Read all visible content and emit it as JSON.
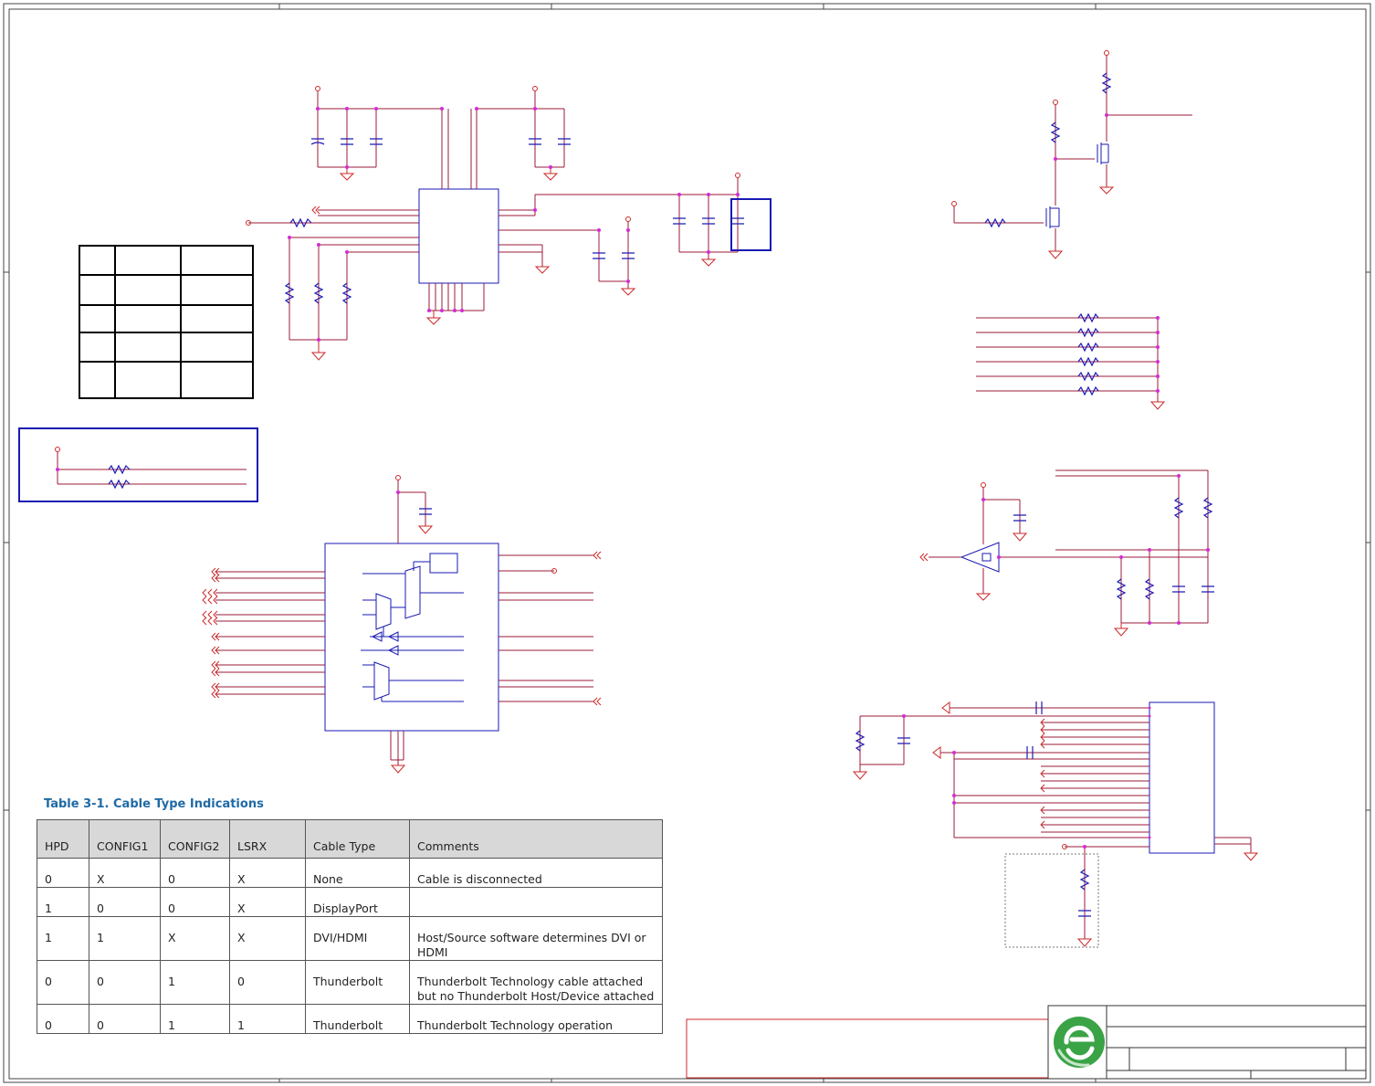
{
  "table": {
    "title": "Table 3-1. Cable Type Indications",
    "headers": [
      "HPD",
      "CONFIG1",
      "CONFIG2",
      "LSRX",
      "Cable Type",
      "Comments"
    ],
    "rows": [
      [
        "0",
        "X",
        "0",
        "X",
        "None",
        "Cable is disconnected"
      ],
      [
        "1",
        "0",
        "0",
        "X",
        "DisplayPort",
        ""
      ],
      [
        "1",
        "1",
        "X",
        "X",
        "DVI/HDMI",
        "Host/Source software determines DVI or HDMI"
      ],
      [
        "0",
        "0",
        "1",
        "0",
        "Thunderbolt",
        "Thunderbolt Technology cable attached but no Thunderbolt Host/Device attached"
      ],
      [
        "0",
        "0",
        "1",
        "1",
        "Thunderbolt",
        "Thunderbolt Technology operation"
      ]
    ]
  },
  "colors": {
    "wire": "#9b1b3a",
    "power": "#cc2a2a",
    "component": "#1a1ab4",
    "junction": "#d42bd4",
    "border": "#333333",
    "logo_green": "#3aa346",
    "table_title": "#1f6aa5"
  },
  "logo": {
    "icon": "e-logo-icon"
  }
}
